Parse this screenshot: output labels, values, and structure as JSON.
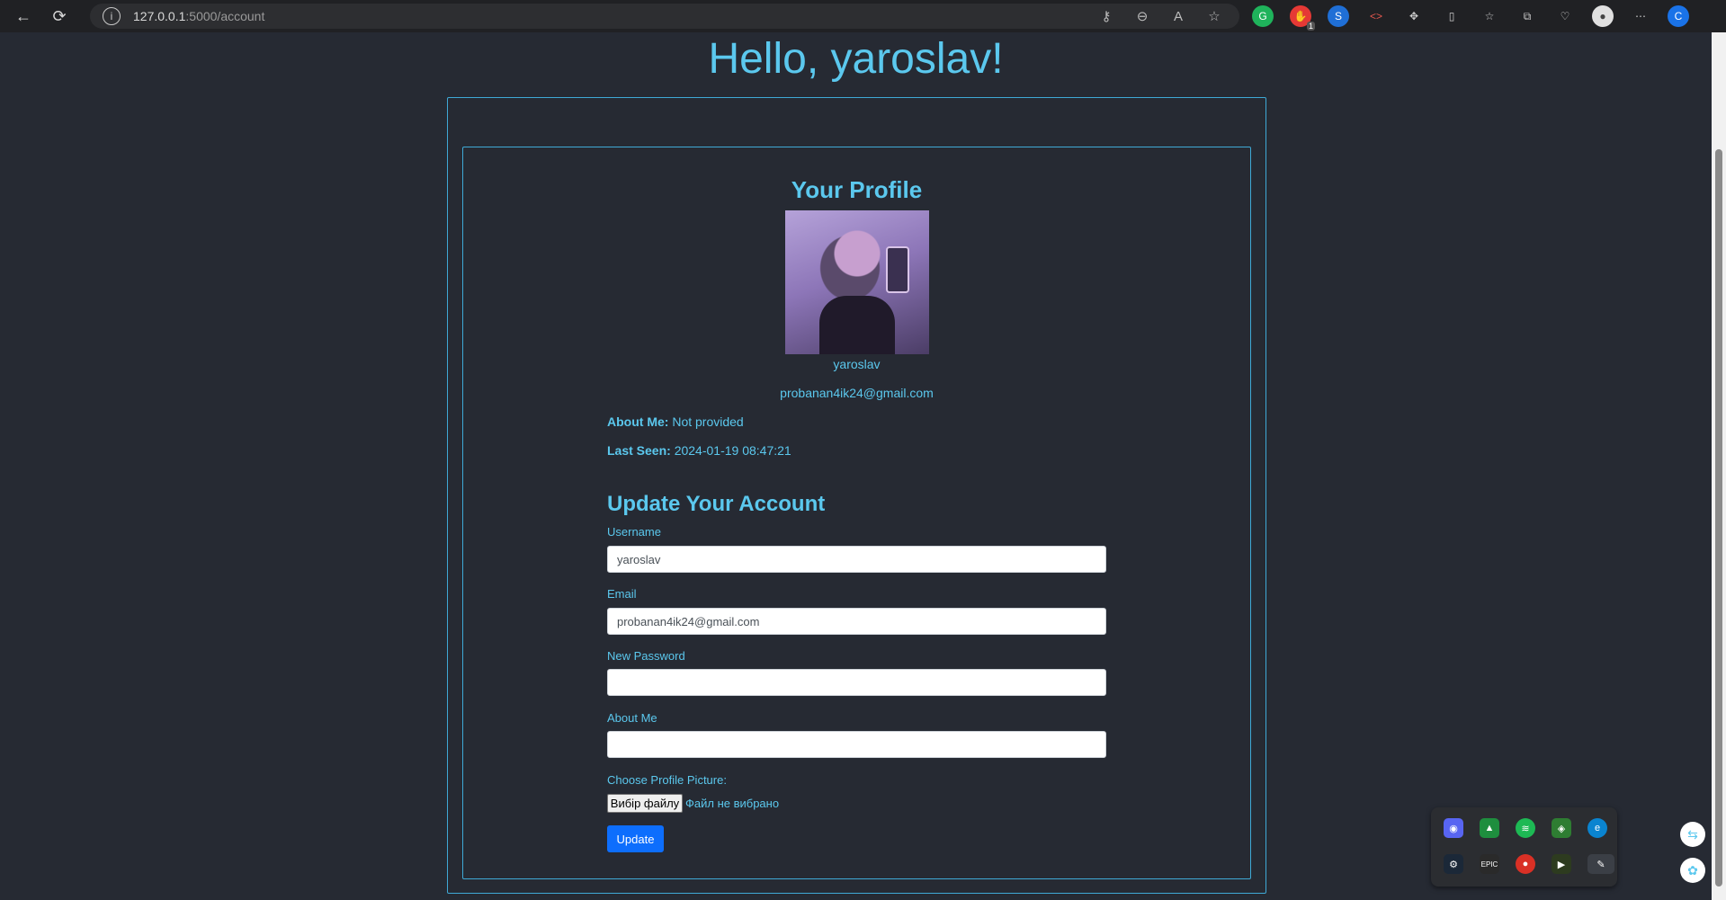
{
  "browser": {
    "url_host": "127.0.0.1",
    "url_path": ":5000/account",
    "extension_badge": "1"
  },
  "page": {
    "greeting": "Hello, yaroslav!",
    "profile_title": "Your Profile",
    "username": "yaroslav",
    "email": "probanan4ik24@gmail.com",
    "about_label": "About Me:",
    "about_value": "Not provided",
    "last_seen_label": "Last Seen:",
    "last_seen_value": "2024-01-19 08:47:21",
    "update_title": "Update Your Account",
    "form": {
      "username_label": "Username",
      "username_value": "yaroslav",
      "email_label": "Email",
      "email_value": "probanan4ik24@gmail.com",
      "password_label": "New Password",
      "password_value": "",
      "about_label": "About Me",
      "about_value": "",
      "picture_label": "Choose Profile Picture:",
      "file_button": "Вибір файлу",
      "file_status": "Файл не вибрано",
      "submit": "Update"
    }
  },
  "colors": {
    "background": "#262a33",
    "accent": "#5bc8ee",
    "button": "#0d6efd"
  }
}
